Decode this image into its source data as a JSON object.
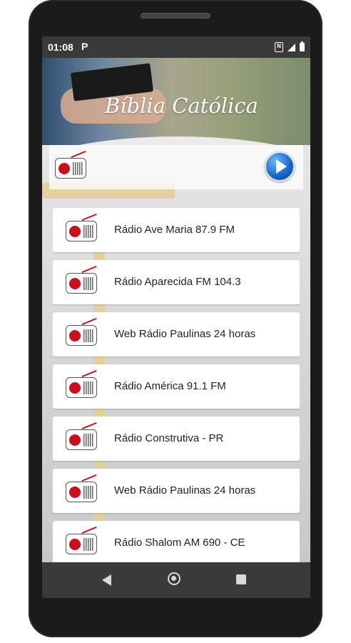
{
  "status_bar": {
    "time": "01:08",
    "notification_icon": "P",
    "icons": [
      "nfc-icon",
      "signal-icon",
      "battery-icon"
    ]
  },
  "banner": {
    "title": "Bíblia Católica"
  },
  "player": {
    "play_icon": "play-icon"
  },
  "stations": [
    {
      "label": "Rádio Ave Maria 87.9 FM"
    },
    {
      "label": "Rádio Aparecida FM 104.3"
    },
    {
      "label": "Web Rádio Paulinas 24 horas"
    },
    {
      "label": "Rádio América 91.1 FM"
    },
    {
      "label": "Rádio Construtiva - PR"
    },
    {
      "label": "Web Rádio Paulinas 24 horas"
    },
    {
      "label": "Rádio Shalom AM 690 - CE"
    }
  ],
  "nav": {
    "icons": [
      "back-icon",
      "home-icon",
      "recents-icon"
    ]
  },
  "colors": {
    "accent_red": "#cc0d1a",
    "play_blue": "#1565c8",
    "cross_gold": "#e2cf96"
  }
}
